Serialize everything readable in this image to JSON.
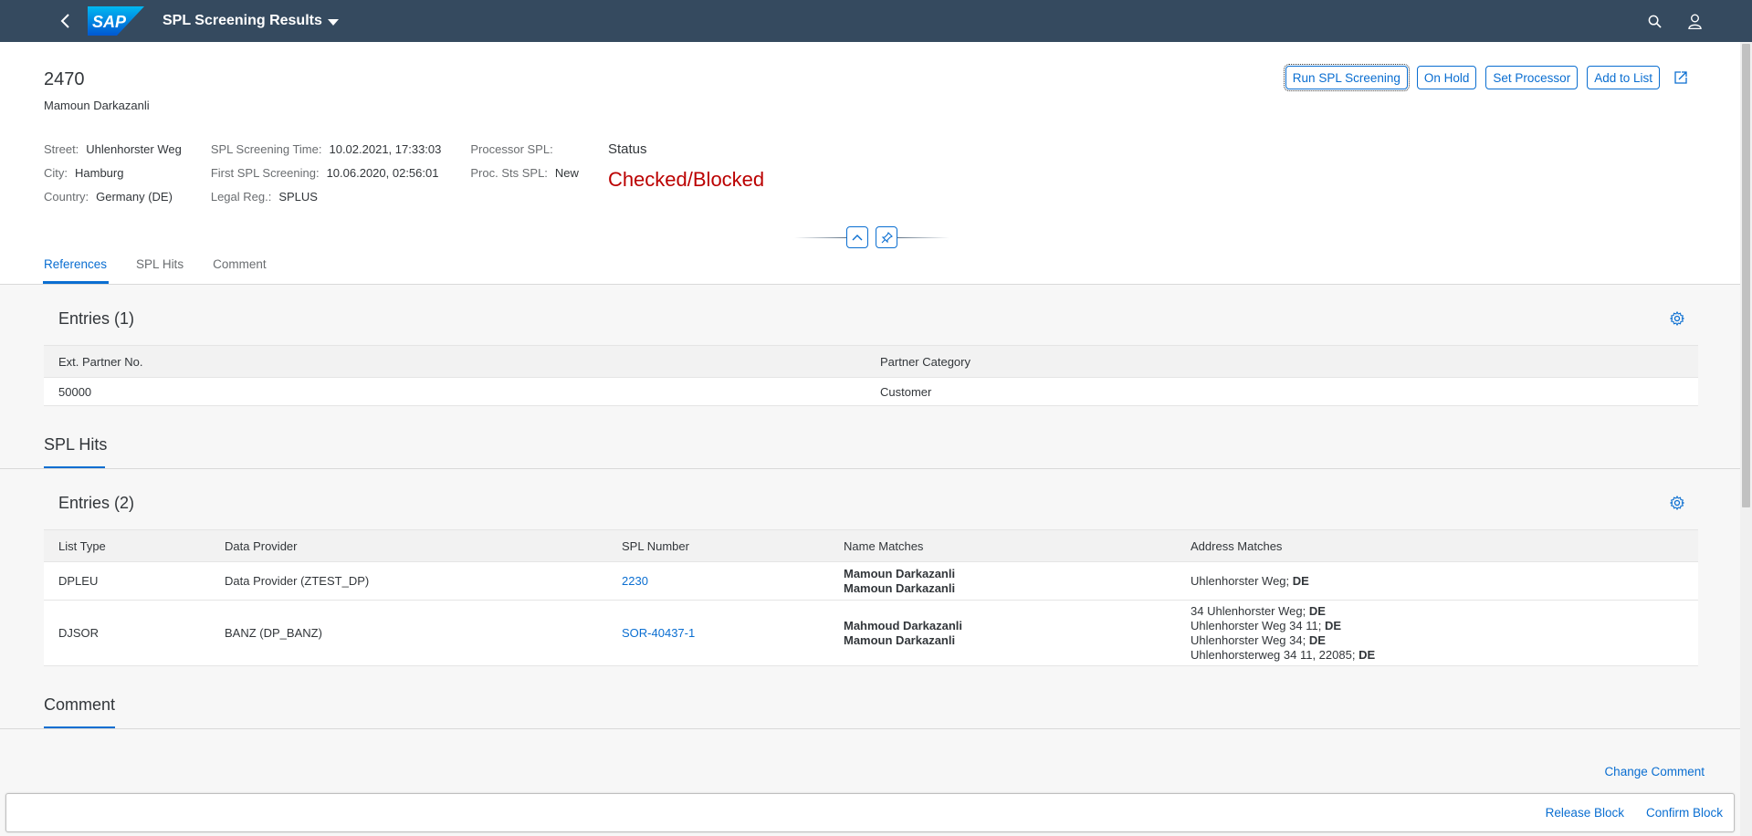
{
  "shell": {
    "title": "SPL Screening Results",
    "logo_text": "SAP",
    "back_icon": "chevron-left-icon",
    "search_icon": "search-icon",
    "user_icon": "user-icon"
  },
  "header": {
    "id": "2470",
    "name": "Mamoun Darkazanli",
    "actions": {
      "run": "Run SPL Screening",
      "hold": "On Hold",
      "processor": "Set Processor",
      "add_list": "Add to List"
    },
    "address": {
      "street_label": "Street:",
      "street": "Uhlenhorster Weg",
      "city_label": "City:",
      "city": "Hamburg",
      "country_label": "Country:",
      "country": "Germany (DE)"
    },
    "screening": {
      "time_label": "SPL Screening Time:",
      "time": "10.02.2021, 17:33:03",
      "first_label": "First SPL Screening:",
      "first": "10.06.2020, 02:56:01",
      "legal_label": "Legal Reg.:",
      "legal": "SPLUS"
    },
    "processor": {
      "proc_label": "Processor SPL:",
      "proc": "",
      "sts_label": "Proc. Sts SPL:",
      "sts": "New"
    },
    "status": {
      "label": "Status",
      "value": "Checked/Blocked",
      "color": "#bb0000"
    }
  },
  "tabs": [
    "References",
    "SPL Hits",
    "Comment"
  ],
  "references": {
    "entries_title": "Entries (1)",
    "columns": [
      "Ext. Partner No.",
      "Partner Category"
    ],
    "rows": [
      [
        "50000",
        "Customer"
      ]
    ]
  },
  "spl_hits": {
    "section_title": "SPL Hits",
    "entries_title": "Entries (2)",
    "columns": [
      "List Type",
      "Data Provider",
      "SPL Number",
      "Name Matches",
      "Address Matches"
    ],
    "rows": [
      {
        "list_type": "DPLEU",
        "provider": "Data Provider (ZTEST_DP)",
        "spl_number": "2230",
        "names": [
          "Mamoun Darkazanli",
          "Mamoun Darkazanli"
        ],
        "addresses": [
          [
            "Uhlenhorster Weg; ",
            "DE"
          ]
        ]
      },
      {
        "list_type": "DJSOR",
        "provider": "BANZ (DP_BANZ)",
        "spl_number": "SOR-40437-1",
        "names": [
          "Mahmoud Darkazanli",
          "Mamoun Darkazanli"
        ],
        "addresses": [
          [
            "34 Uhlenhorster Weg; ",
            "DE"
          ],
          [
            "Uhlenhorster Weg 34 11; ",
            "DE"
          ],
          [
            "Uhlenhorster Weg 34; ",
            "DE"
          ],
          [
            "Uhlenhorsterweg 34 11, 22085; ",
            "DE"
          ]
        ]
      }
    ]
  },
  "comment": {
    "section_title": "Comment",
    "change_label": "Change Comment"
  },
  "footer": {
    "release": "Release Block",
    "confirm": "Confirm Block"
  },
  "colors": {
    "shell": "#354a5f",
    "accent": "#0a6ed1",
    "negative": "#bb0000"
  }
}
